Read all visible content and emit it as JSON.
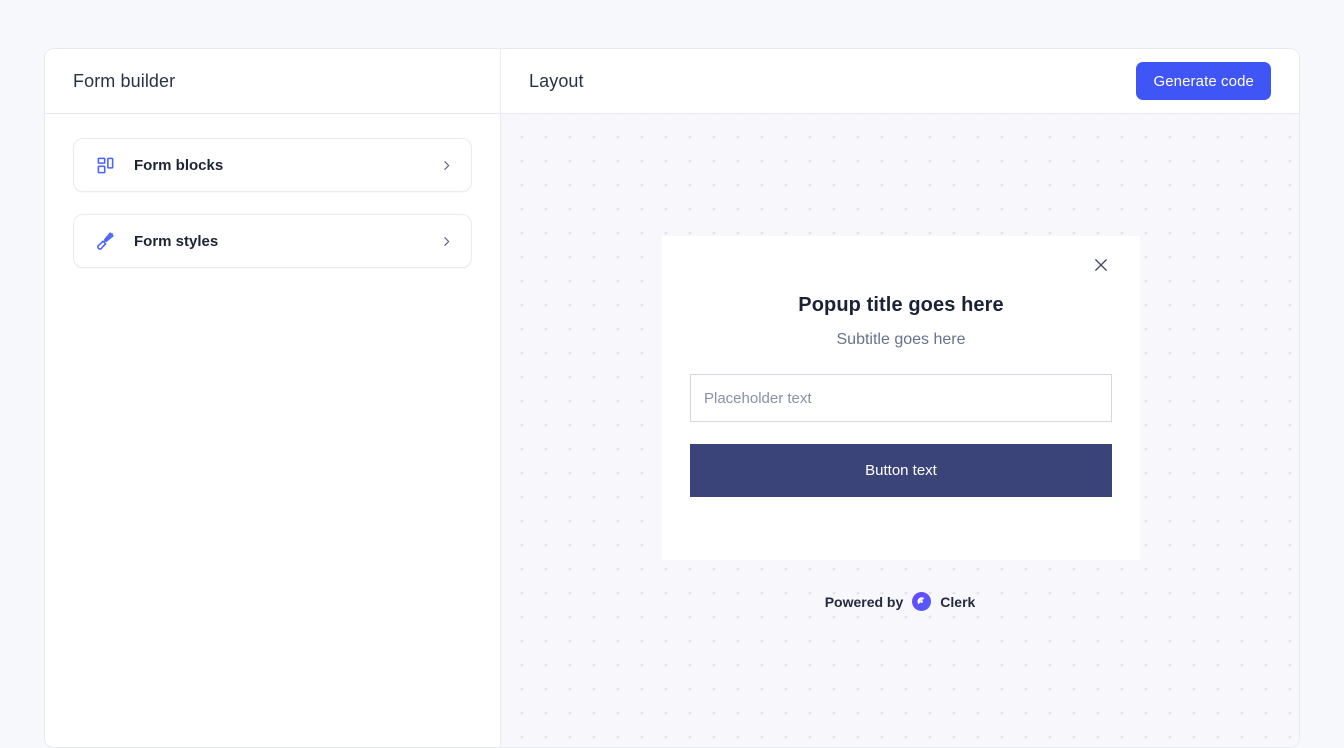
{
  "theme": {
    "page_background": "#f7f8fb",
    "accent_blue": "#4055f5",
    "icon_blue": "#4a64f5",
    "popup_button_navy": "#3b4479",
    "clerk_purple": "#6c47ff",
    "canvas_background": "#f8f8fc",
    "canvas_dot_color": "#e2e3ee"
  },
  "left_panel": {
    "title": "Form builder",
    "items": [
      {
        "label": "Form blocks",
        "icon": "layout-dashboard-icon",
        "chevron": "chevron-right-icon"
      },
      {
        "label": "Form styles",
        "icon": "paintbrush-icon",
        "chevron": "chevron-right-icon"
      }
    ]
  },
  "right_panel": {
    "title": "Layout",
    "generate_button": "Generate code"
  },
  "popup": {
    "close_icon": "close-icon",
    "title": "Popup title goes here",
    "subtitle": "Subtitle goes here",
    "input_placeholder": "Placeholder text",
    "input_value": "",
    "button_label": "Button text"
  },
  "footer": {
    "powered_by": "Powered by",
    "brand": "Clerk",
    "brand_icon": "clerk-logo-icon"
  }
}
